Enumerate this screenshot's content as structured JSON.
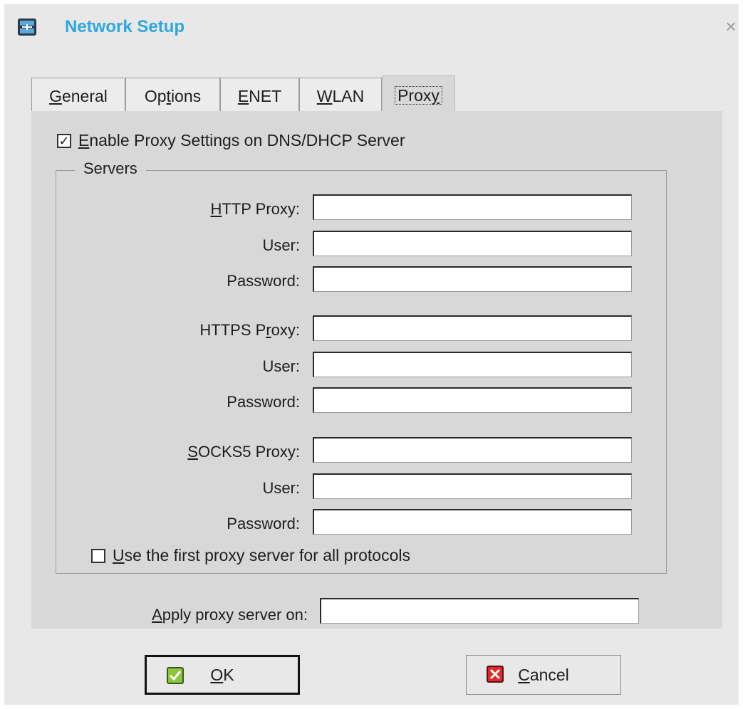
{
  "window": {
    "title": "Network Setup",
    "close_glyph": "×",
    "icon": "network-icon"
  },
  "tabs": [
    {
      "pre": "",
      "key": "G",
      "post": "eneral"
    },
    {
      "pre": "Op",
      "key": "t",
      "post": "ions"
    },
    {
      "pre": "",
      "key": "E",
      "post": "NET"
    },
    {
      "pre": "",
      "key": "W",
      "post": "LAN"
    },
    {
      "pre": "Prox",
      "key": "y",
      "post": "",
      "active": true
    }
  ],
  "proxy": {
    "enable": {
      "checked": true,
      "check_glyph": "✓",
      "key": "E",
      "rest": "nable Proxy Settings on DNS/DHCP Server"
    },
    "servers_legend": "Servers",
    "http": {
      "proxy_label": {
        "pre": "",
        "key": "H",
        "post": "TTP Proxy:"
      },
      "user_label": "User:",
      "password_label": "Password:",
      "proxy_value": "",
      "user_value": "",
      "password_value": ""
    },
    "https": {
      "proxy_label": {
        "pre": "HTTPS P",
        "key": "r",
        "post": "oxy:"
      },
      "user_label": "User:",
      "password_label": "Password:",
      "proxy_value": "",
      "user_value": "",
      "password_value": ""
    },
    "socks5": {
      "proxy_label": {
        "pre": "",
        "key": "S",
        "post": "OCKS5 Proxy:"
      },
      "user_label": "User:",
      "password_label": "Password:",
      "proxy_value": "",
      "user_value": "",
      "password_value": ""
    },
    "use_first": {
      "checked": false,
      "key": "U",
      "rest": "se the first proxy server for all protocols"
    },
    "apply_on": {
      "key": "A",
      "rest": "pply proxy server on:",
      "value": ""
    }
  },
  "buttons": {
    "ok": {
      "key": "O",
      "rest": "K",
      "icon": "check-icon",
      "icon_color": "#8cc63f"
    },
    "cancel": {
      "key": "C",
      "rest": "ancel",
      "icon": "cross-icon",
      "icon_color": "#e02a2a"
    }
  },
  "colors": {
    "title": "#2ea7df",
    "panel": "#d8d8d8",
    "background": "#e8e8e8"
  }
}
